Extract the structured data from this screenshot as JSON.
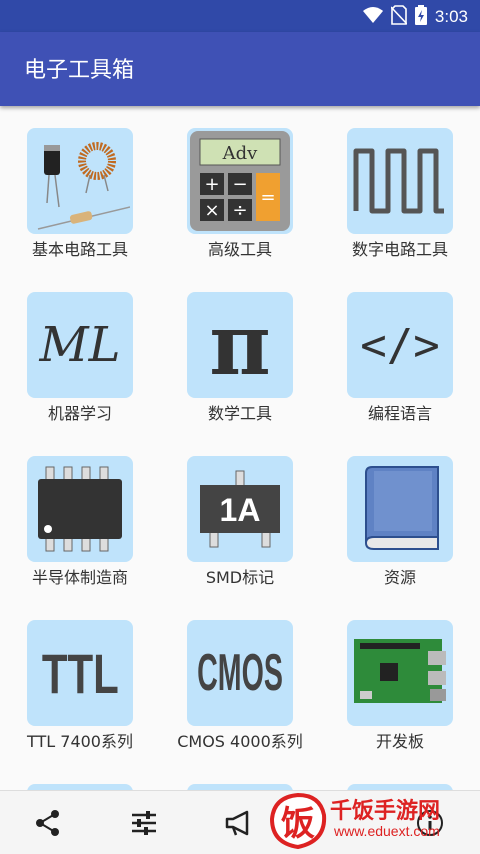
{
  "status_bar": {
    "time": "3:03"
  },
  "app": {
    "title": "电子工具箱"
  },
  "tiles": [
    {
      "label": "基本电路工具",
      "icon": "components-icon"
    },
    {
      "label": "高级工具",
      "icon": "calculator-icon",
      "calc_screen": "Adv"
    },
    {
      "label": "数字电路工具",
      "icon": "square-wave-icon"
    },
    {
      "label": "机器学习",
      "icon": "ml-icon",
      "text": "ML"
    },
    {
      "label": "数学工具",
      "icon": "pi-icon",
      "text": "π"
    },
    {
      "label": "编程语言",
      "icon": "code-icon",
      "text": "</>"
    },
    {
      "label": "半导体制造商",
      "icon": "chip-icon"
    },
    {
      "label": "SMD标记",
      "icon": "smd-icon",
      "text": "1A"
    },
    {
      "label": "资源",
      "icon": "book-icon"
    },
    {
      "label": "TTL 7400系列",
      "icon": "ttl-icon",
      "text": "TTL"
    },
    {
      "label": "CMOS 4000系列",
      "icon": "cmos-icon",
      "text": "CMOS"
    },
    {
      "label": "开发板",
      "icon": "board-icon"
    }
  ],
  "bottom_bar": {
    "icons": [
      "share-icon",
      "settings-sliders-icon",
      "megaphone-icon",
      "info-icon"
    ]
  },
  "watermark": {
    "brand": "千饭手游网",
    "url": "www.eduext.com",
    "logo_char": "饭"
  }
}
